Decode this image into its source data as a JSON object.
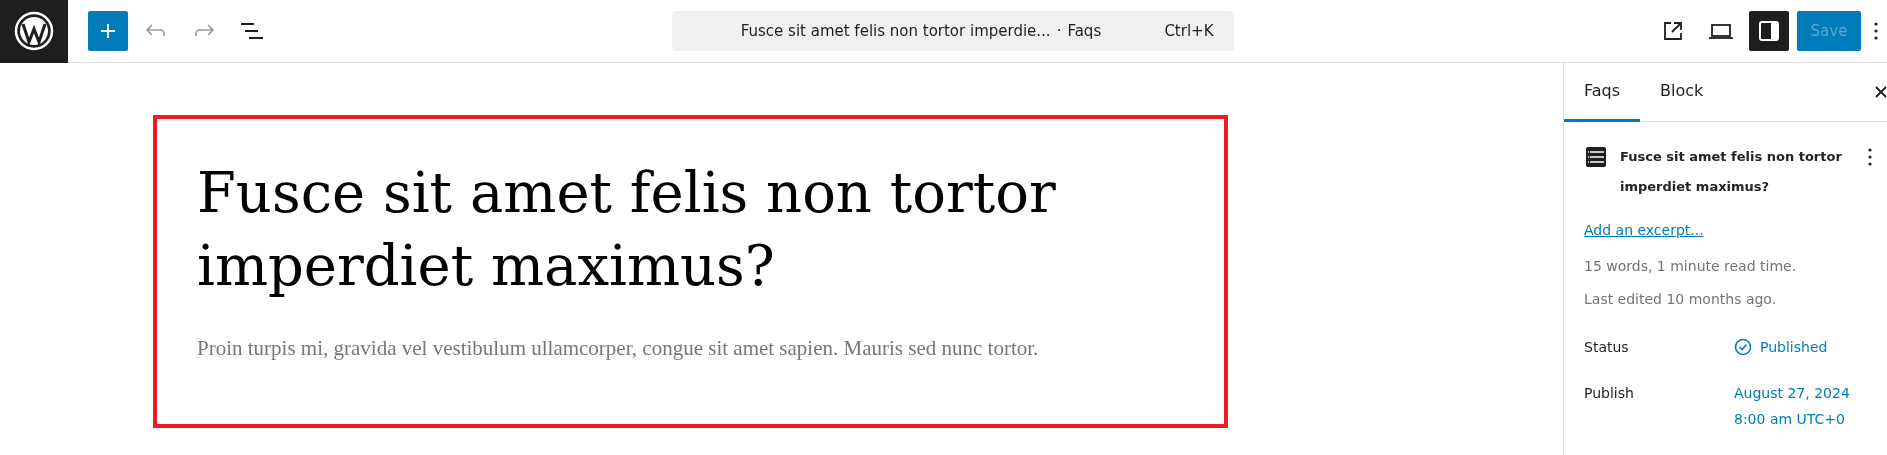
{
  "toolbar": {
    "save_button": "Save",
    "save_disabled": true,
    "sidebar_toggle_on": true
  },
  "command_bar": {
    "title": "Fusce sit amet felis non tortor imperdie...",
    "separator": "·",
    "post_type": "Faqs",
    "shortcut": "Ctrl+K"
  },
  "editor": {
    "heading": "Fusce sit amet felis non tortor imperdiet maximus?",
    "paragraph": "Proin turpis mi, gravida vel vestibulum ullamcorper, congue sit amet sapien. Mauris sed nunc tortor."
  },
  "sidebar": {
    "tabs": [
      {
        "label": "Faqs",
        "selected": true
      },
      {
        "label": "Block",
        "selected": false
      }
    ],
    "post_title": "Fusce sit amet felis non tortor imperdiet maximus?",
    "excerpt_link": "Add an excerpt...",
    "meta": [
      "15 words, 1 minute read time.",
      "Last edited 10 months ago."
    ],
    "fields": [
      {
        "label": "Status",
        "value": "Published",
        "kind": "status"
      },
      {
        "label": "Publish",
        "value": "August 27, 2024 8:00 am UTC+0",
        "kind": "date"
      }
    ]
  }
}
